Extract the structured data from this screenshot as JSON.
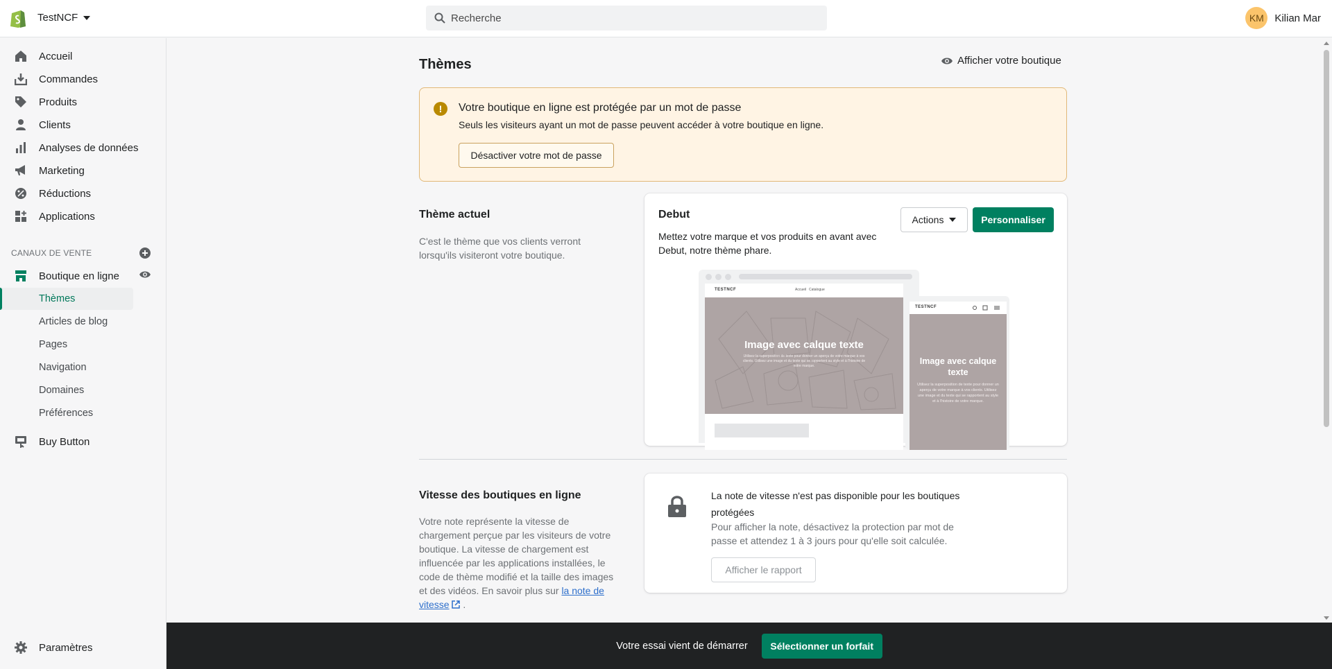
{
  "topbar": {
    "store_name": "TestNCF",
    "search_placeholder": "Recherche",
    "user_initials": "KM",
    "user_name": "Kilian Mar"
  },
  "sidebar": {
    "items": [
      {
        "label": "Accueil",
        "icon": "home-icon"
      },
      {
        "label": "Commandes",
        "icon": "orders-icon"
      },
      {
        "label": "Produits",
        "icon": "tag-icon"
      },
      {
        "label": "Clients",
        "icon": "person-icon"
      },
      {
        "label": "Analyses de données",
        "icon": "bar-chart-icon"
      },
      {
        "label": "Marketing",
        "icon": "megaphone-icon"
      },
      {
        "label": "Réductions",
        "icon": "discount-icon"
      },
      {
        "label": "Applications",
        "icon": "apps-icon"
      }
    ],
    "sales_channels_label": "CANAUX DE VENTE",
    "online_store_label": "Boutique en ligne",
    "sub_items": [
      "Thèmes",
      "Articles de blog",
      "Pages",
      "Navigation",
      "Domaines",
      "Préférences"
    ],
    "buy_button_label": "Buy Button",
    "settings_label": "Paramètres"
  },
  "main": {
    "title": "Thèmes",
    "view_store": "Afficher votre boutique",
    "banner": {
      "title": "Votre boutique en ligne est protégée par un mot de passe",
      "text": "Seuls les visiteurs ayant un mot de passe peuvent accéder à votre boutique en ligne.",
      "button": "Désactiver votre mot de passe"
    },
    "current_theme": {
      "section_title": "Thème actuel",
      "section_desc_1": "C'est le thème que vos clients verront",
      "section_desc_2": "lorsqu'ils visiteront votre boutique.",
      "name": "Debut",
      "desc": "Mettez votre marque et vos produits en avant avec Debut, notre thème phare.",
      "actions_button": "Actions",
      "customize_button": "Personnaliser",
      "preview": {
        "brand": "TESTNCF",
        "nav_1": "Accueil",
        "nav_2": "Catalogue",
        "hero_title": "Image avec calque texte",
        "hero_text": "Utilisez la superposition de texte pour donner un aperçu de votre marque à vos clients. Utilisez une image et du texte qui se rapportent au style et à l'histoire de votre marque."
      }
    },
    "speed": {
      "section_title": "Vitesse des boutiques en ligne",
      "desc_1": "Votre note représente la vitesse de",
      "desc_2": "chargement perçue par les visiteurs de votre",
      "desc_3": "boutique. La vitesse de chargement est",
      "desc_4": "influencée par les applications installées, le",
      "desc_5": "code de thème modifié et la taille des images",
      "desc_6": "et des vidéos. En savoir plus sur",
      "link_1": "la note de",
      "link_2": "vitesse",
      "card_title": "La note de vitesse n'est pas disponible pour les boutiques protégées",
      "card_text": "Pour afficher la note, désactivez la protection par mot de passe et attendez 1 à 3 jours pour qu'elle soit calculée.",
      "report_button": "Afficher le rapport"
    }
  },
  "trial": {
    "text": "Votre essai vient de démarrer",
    "button": "Sélectionner un forfait"
  },
  "colors": {
    "primary": "#008060",
    "banner_bg": "#fff4e4",
    "banner_border": "#e1b878",
    "trial_bar": "#202223"
  }
}
